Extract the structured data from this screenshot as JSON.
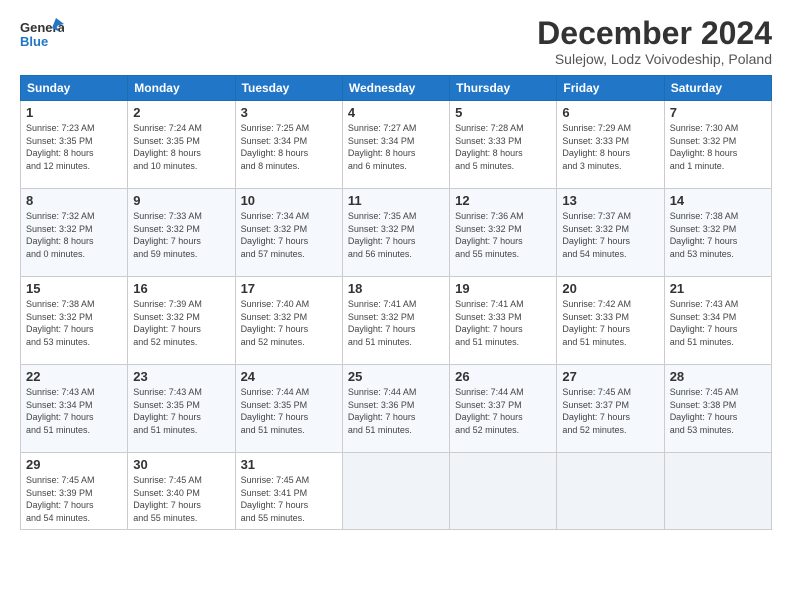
{
  "header": {
    "logo_text_general": "General",
    "logo_text_blue": "Blue",
    "month": "December 2024",
    "location": "Sulejow, Lodz Voivodeship, Poland"
  },
  "weekdays": [
    "Sunday",
    "Monday",
    "Tuesday",
    "Wednesday",
    "Thursday",
    "Friday",
    "Saturday"
  ],
  "weeks": [
    [
      {
        "day": "1",
        "info": "Sunrise: 7:23 AM\nSunset: 3:35 PM\nDaylight: 8 hours\nand 12 minutes."
      },
      {
        "day": "2",
        "info": "Sunrise: 7:24 AM\nSunset: 3:35 PM\nDaylight: 8 hours\nand 10 minutes."
      },
      {
        "day": "3",
        "info": "Sunrise: 7:25 AM\nSunset: 3:34 PM\nDaylight: 8 hours\nand 8 minutes."
      },
      {
        "day": "4",
        "info": "Sunrise: 7:27 AM\nSunset: 3:34 PM\nDaylight: 8 hours\nand 6 minutes."
      },
      {
        "day": "5",
        "info": "Sunrise: 7:28 AM\nSunset: 3:33 PM\nDaylight: 8 hours\nand 5 minutes."
      },
      {
        "day": "6",
        "info": "Sunrise: 7:29 AM\nSunset: 3:33 PM\nDaylight: 8 hours\nand 3 minutes."
      },
      {
        "day": "7",
        "info": "Sunrise: 7:30 AM\nSunset: 3:32 PM\nDaylight: 8 hours\nand 1 minute."
      }
    ],
    [
      {
        "day": "8",
        "info": "Sunrise: 7:32 AM\nSunset: 3:32 PM\nDaylight: 8 hours\nand 0 minutes."
      },
      {
        "day": "9",
        "info": "Sunrise: 7:33 AM\nSunset: 3:32 PM\nDaylight: 7 hours\nand 59 minutes."
      },
      {
        "day": "10",
        "info": "Sunrise: 7:34 AM\nSunset: 3:32 PM\nDaylight: 7 hours\nand 57 minutes."
      },
      {
        "day": "11",
        "info": "Sunrise: 7:35 AM\nSunset: 3:32 PM\nDaylight: 7 hours\nand 56 minutes."
      },
      {
        "day": "12",
        "info": "Sunrise: 7:36 AM\nSunset: 3:32 PM\nDaylight: 7 hours\nand 55 minutes."
      },
      {
        "day": "13",
        "info": "Sunrise: 7:37 AM\nSunset: 3:32 PM\nDaylight: 7 hours\nand 54 minutes."
      },
      {
        "day": "14",
        "info": "Sunrise: 7:38 AM\nSunset: 3:32 PM\nDaylight: 7 hours\nand 53 minutes."
      }
    ],
    [
      {
        "day": "15",
        "info": "Sunrise: 7:38 AM\nSunset: 3:32 PM\nDaylight: 7 hours\nand 53 minutes."
      },
      {
        "day": "16",
        "info": "Sunrise: 7:39 AM\nSunset: 3:32 PM\nDaylight: 7 hours\nand 52 minutes."
      },
      {
        "day": "17",
        "info": "Sunrise: 7:40 AM\nSunset: 3:32 PM\nDaylight: 7 hours\nand 52 minutes."
      },
      {
        "day": "18",
        "info": "Sunrise: 7:41 AM\nSunset: 3:32 PM\nDaylight: 7 hours\nand 51 minutes."
      },
      {
        "day": "19",
        "info": "Sunrise: 7:41 AM\nSunset: 3:33 PM\nDaylight: 7 hours\nand 51 minutes."
      },
      {
        "day": "20",
        "info": "Sunrise: 7:42 AM\nSunset: 3:33 PM\nDaylight: 7 hours\nand 51 minutes."
      },
      {
        "day": "21",
        "info": "Sunrise: 7:43 AM\nSunset: 3:34 PM\nDaylight: 7 hours\nand 51 minutes."
      }
    ],
    [
      {
        "day": "22",
        "info": "Sunrise: 7:43 AM\nSunset: 3:34 PM\nDaylight: 7 hours\nand 51 minutes."
      },
      {
        "day": "23",
        "info": "Sunrise: 7:43 AM\nSunset: 3:35 PM\nDaylight: 7 hours\nand 51 minutes."
      },
      {
        "day": "24",
        "info": "Sunrise: 7:44 AM\nSunset: 3:35 PM\nDaylight: 7 hours\nand 51 minutes."
      },
      {
        "day": "25",
        "info": "Sunrise: 7:44 AM\nSunset: 3:36 PM\nDaylight: 7 hours\nand 51 minutes."
      },
      {
        "day": "26",
        "info": "Sunrise: 7:44 AM\nSunset: 3:37 PM\nDaylight: 7 hours\nand 52 minutes."
      },
      {
        "day": "27",
        "info": "Sunrise: 7:45 AM\nSunset: 3:37 PM\nDaylight: 7 hours\nand 52 minutes."
      },
      {
        "day": "28",
        "info": "Sunrise: 7:45 AM\nSunset: 3:38 PM\nDaylight: 7 hours\nand 53 minutes."
      }
    ],
    [
      {
        "day": "29",
        "info": "Sunrise: 7:45 AM\nSunset: 3:39 PM\nDaylight: 7 hours\nand 54 minutes."
      },
      {
        "day": "30",
        "info": "Sunrise: 7:45 AM\nSunset: 3:40 PM\nDaylight: 7 hours\nand 55 minutes."
      },
      {
        "day": "31",
        "info": "Sunrise: 7:45 AM\nSunset: 3:41 PM\nDaylight: 7 hours\nand 55 minutes."
      },
      {
        "day": "",
        "info": ""
      },
      {
        "day": "",
        "info": ""
      },
      {
        "day": "",
        "info": ""
      },
      {
        "day": "",
        "info": ""
      }
    ]
  ]
}
